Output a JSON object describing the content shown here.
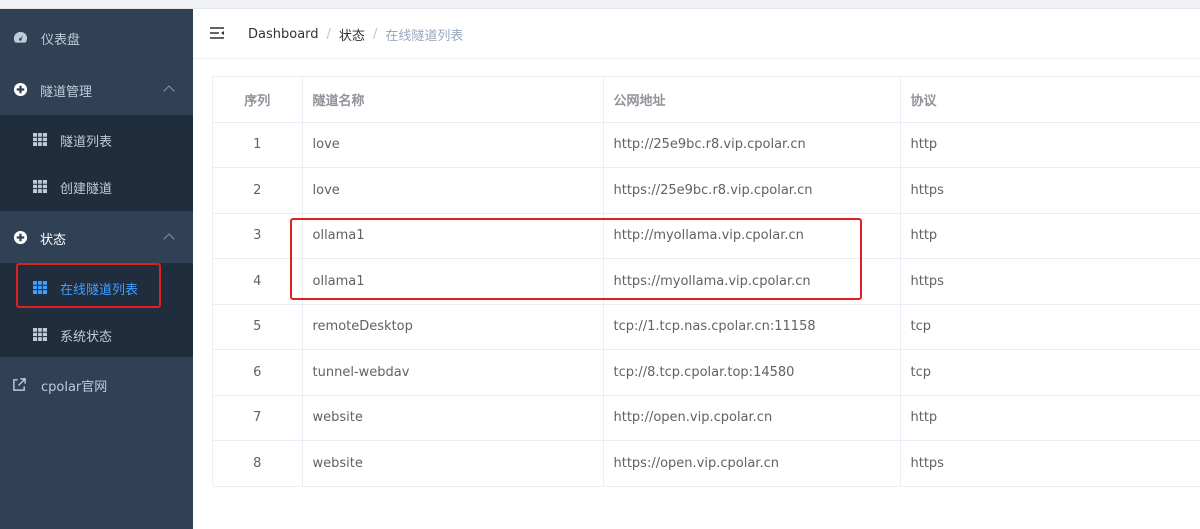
{
  "sidebar": {
    "items": [
      {
        "label": "仪表盘",
        "icon": "dashboard-icon"
      },
      {
        "label": "隧道管理",
        "icon": "tunnel-manage-icon",
        "expanded": true,
        "children": [
          {
            "label": "隧道列表",
            "icon": "table-icon"
          },
          {
            "label": "创建隧道",
            "icon": "table-icon"
          }
        ]
      },
      {
        "label": "状态",
        "icon": "status-icon",
        "expanded": true,
        "children": [
          {
            "label": "在线隧道列表",
            "icon": "table-icon",
            "active": true
          },
          {
            "label": "系统状态",
            "icon": "table-icon"
          }
        ]
      },
      {
        "label": "cpolar官网",
        "icon": "external-link-icon"
      }
    ]
  },
  "header": {
    "breadcrumb": [
      "Dashboard",
      "状态",
      "在线隧道列表"
    ]
  },
  "table": {
    "columns": [
      "序列",
      "隧道名称",
      "公网地址",
      "协议"
    ],
    "rows": [
      [
        "1",
        "love",
        "http://25e9bc.r8.vip.cpolar.cn",
        "http"
      ],
      [
        "2",
        "love",
        "https://25e9bc.r8.vip.cpolar.cn",
        "https"
      ],
      [
        "3",
        "ollama1",
        "http://myollama.vip.cpolar.cn",
        "http"
      ],
      [
        "4",
        "ollama1",
        "https://myollama.vip.cpolar.cn",
        "https"
      ],
      [
        "5",
        "remoteDesktop",
        "tcp://1.tcp.nas.cpolar.cn:11158",
        "tcp"
      ],
      [
        "6",
        "tunnel-webdav",
        "tcp://8.tcp.cpolar.top:14580",
        "tcp"
      ],
      [
        "7",
        "website",
        "http://open.vip.cpolar.cn",
        "http"
      ],
      [
        "8",
        "website",
        "https://open.vip.cpolar.cn",
        "https"
      ]
    ]
  },
  "colors": {
    "sidebar_bg": "#304156",
    "submenu_bg": "#1f2d3d",
    "active": "#409eff",
    "highlight": "#e02020"
  }
}
